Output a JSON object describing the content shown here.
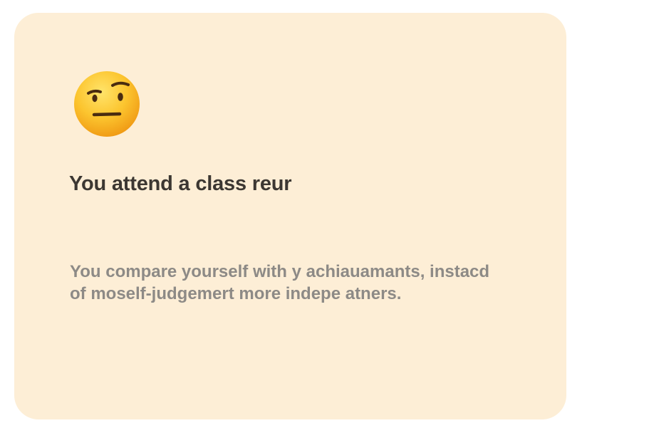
{
  "card": {
    "icon": "raised-eyebrow-face-emoji",
    "title": "You attend a class reur",
    "description": "You compare yourself with y achiauamants, instacd of moself-judgemert more indepe atners."
  },
  "colors": {
    "card_background": "#fdeed6",
    "title_text": "#3c3732",
    "body_text": "#8d8a86",
    "emoji_face": "#fbc02d"
  }
}
